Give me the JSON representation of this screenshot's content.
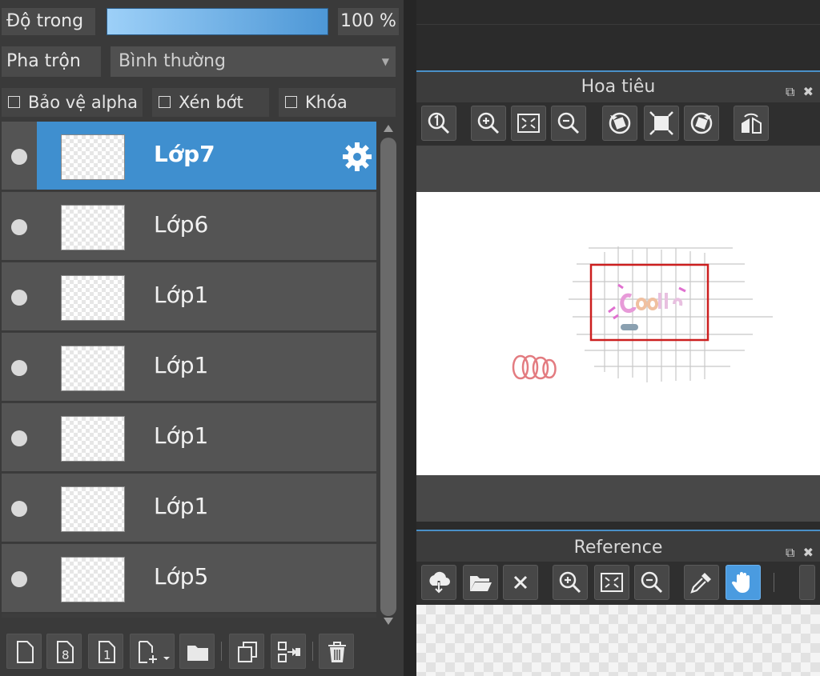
{
  "layer_panel": {
    "opacity_label": "Độ trong",
    "opacity_value": "100 %",
    "opacity_percent": 100,
    "blend_label": "Pha trộn",
    "blend_value": "Bình thường",
    "checkboxes": [
      {
        "label": "Bảo vệ alpha",
        "checked": false
      },
      {
        "label": "Xén bớt",
        "checked": false
      },
      {
        "label": "Khóa",
        "checked": false
      }
    ],
    "layers": [
      {
        "name": "Lớp7",
        "selected": true
      },
      {
        "name": "Lớp6",
        "selected": false
      },
      {
        "name": "Lớp1",
        "selected": false
      },
      {
        "name": "Lớp1",
        "selected": false
      },
      {
        "name": "Lớp1",
        "selected": false
      },
      {
        "name": "Lớp1",
        "selected": false
      },
      {
        "name": "Lớp5",
        "selected": false
      }
    ],
    "toolbar_icons": [
      "new-layer-icon",
      "new-8bit-layer-icon",
      "new-1bit-layer-icon",
      "add-layer-menu-icon",
      "folder-icon",
      "duplicate-layer-icon",
      "merge-down-icon",
      "trash-icon"
    ],
    "new_8bit_glyph": "8",
    "new_1bit_glyph": "1"
  },
  "navigator": {
    "title": "Hoa tiêu",
    "toolbar_icons": [
      "zoom-actual-icon",
      "zoom-in-icon",
      "fit-screen-icon",
      "zoom-out-icon",
      "rotate-left-icon",
      "fit-canvas-icon",
      "rotate-right-icon",
      "flip-horizontal-icon"
    ]
  },
  "reference": {
    "title": "Reference",
    "toolbar_icons": [
      "download-icon",
      "open-folder-icon",
      "close-icon",
      "zoom-in-icon",
      "fit-screen-icon",
      "zoom-out-icon",
      "eyedropper-icon",
      "hand-icon"
    ],
    "active_tool": "hand-icon"
  },
  "colors": {
    "accent": "#4a90c8",
    "selected_layer": "#3f8fcf",
    "panel_bg": "#3a3a3a",
    "navigator_frame": "#cc1f1f"
  }
}
